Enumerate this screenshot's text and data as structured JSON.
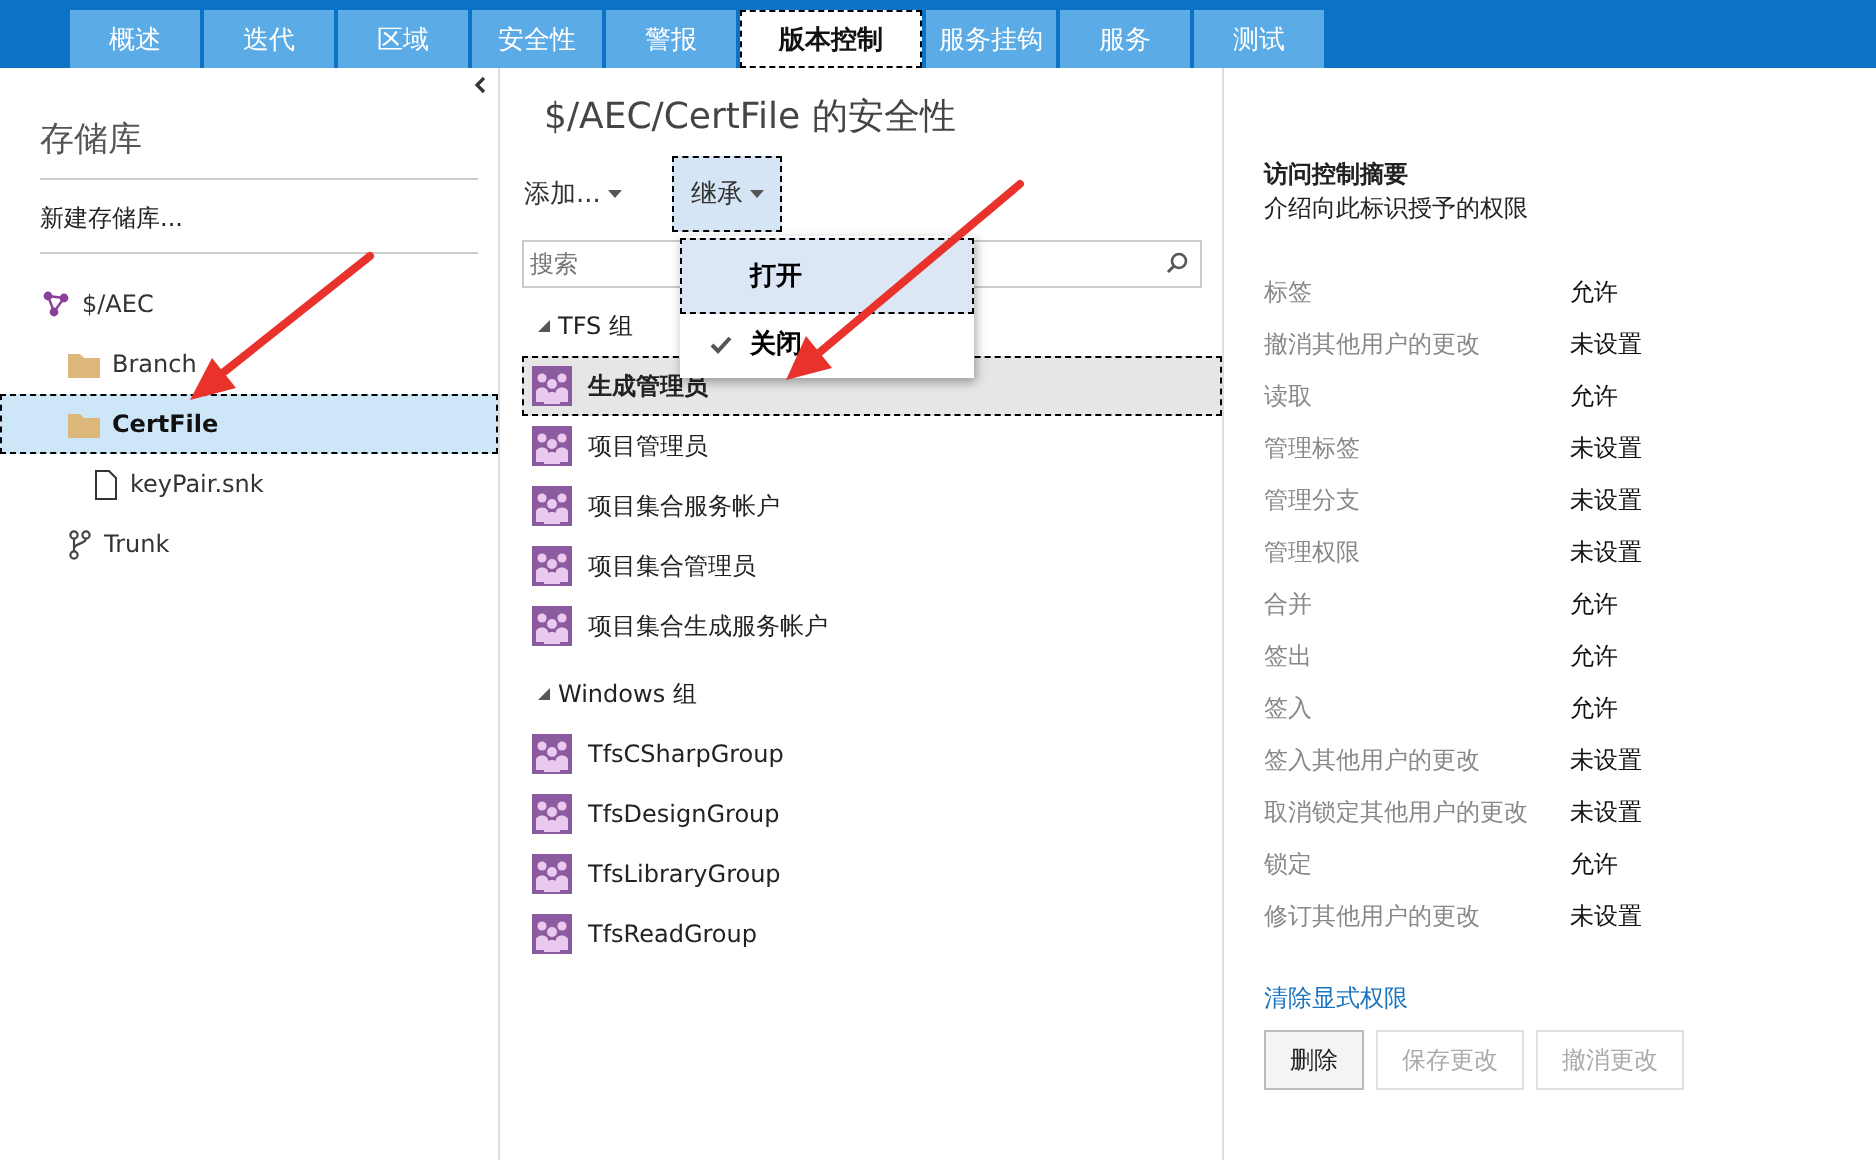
{
  "tabs": [
    {
      "label": "概述",
      "selected": false
    },
    {
      "label": "迭代",
      "selected": false
    },
    {
      "label": "区域",
      "selected": false
    },
    {
      "label": "安全性",
      "selected": false
    },
    {
      "label": "警报",
      "selected": false
    },
    {
      "label": "版本控制",
      "selected": true
    },
    {
      "label": "服务挂钩",
      "selected": false
    },
    {
      "label": "服务",
      "selected": false
    },
    {
      "label": "测试",
      "selected": false
    }
  ],
  "sidebar": {
    "title": "存储库",
    "new_link": "新建存储库...",
    "tree": [
      {
        "label": "$/AEC",
        "kind": "repo",
        "selected": false,
        "children": [
          {
            "label": "Branch",
            "kind": "folder",
            "selected": false
          },
          {
            "label": "CertFile",
            "kind": "folder",
            "selected": true,
            "children": [
              {
                "label": "keyPair.snk",
                "kind": "file",
                "selected": false
              }
            ]
          },
          {
            "label": "Trunk",
            "kind": "branch",
            "selected": false
          }
        ]
      }
    ]
  },
  "main": {
    "title": "$/AEC/CertFile 的安全性",
    "toolbar": [
      {
        "label": "添加...",
        "selected": false
      },
      {
        "label": "继承",
        "selected": true
      }
    ],
    "search": {
      "placeholder": "搜索"
    },
    "groups": [
      {
        "label": "TFS 组",
        "expanded": true,
        "members": [
          {
            "name": "生成管理员",
            "selected": true
          },
          {
            "name": "项目管理员",
            "selected": false
          },
          {
            "name": "项目集合服务帐户",
            "selected": false
          },
          {
            "name": "项目集合管理员",
            "selected": false
          },
          {
            "name": "项目集合生成服务帐户",
            "selected": false
          }
        ]
      },
      {
        "label": "Windows 组",
        "expanded": true,
        "members": [
          {
            "name": "TfsCSharpGroup",
            "selected": false
          },
          {
            "name": "TfsDesignGroup",
            "selected": false
          },
          {
            "name": "TfsLibraryGroup",
            "selected": false
          },
          {
            "name": "TfsReadGroup",
            "selected": false
          }
        ]
      }
    ],
    "inherit_menu": {
      "items": [
        {
          "label": "打开",
          "checked": false,
          "selected": true
        },
        {
          "label": "关闭",
          "checked": true,
          "selected": false
        }
      ]
    }
  },
  "summary": {
    "title": "访问控制摘要",
    "subtitle": "介绍向此标识授予的权限",
    "permissions": [
      {
        "name": "标签",
        "value": "允许"
      },
      {
        "name": "撤消其他用户的更改",
        "value": "未设置"
      },
      {
        "name": "读取",
        "value": "允许"
      },
      {
        "name": "管理标签",
        "value": "未设置"
      },
      {
        "name": "管理分支",
        "value": "未设置"
      },
      {
        "name": "管理权限",
        "value": "未设置"
      },
      {
        "name": "合并",
        "value": "允许"
      },
      {
        "name": "签出",
        "value": "允许"
      },
      {
        "name": "签入",
        "value": "允许"
      },
      {
        "name": "签入其他用户的更改",
        "value": "未设置"
      },
      {
        "name": "取消锁定其他用户的更改",
        "value": "未设置"
      },
      {
        "name": "锁定",
        "value": "允许"
      },
      {
        "name": "修订其他用户的更改",
        "value": "未设置"
      }
    ],
    "clear_link": "清除显式权限",
    "buttons": [
      {
        "label": "删除",
        "disabled": false
      },
      {
        "label": "保存更改",
        "disabled": true
      },
      {
        "label": "撤消更改",
        "disabled": true
      }
    ]
  }
}
